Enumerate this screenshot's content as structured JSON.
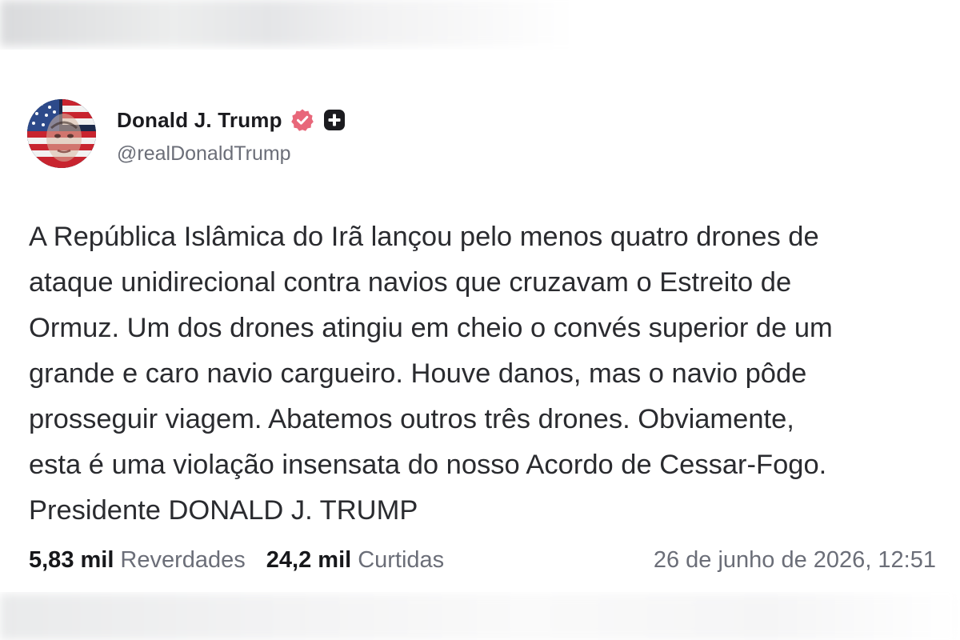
{
  "post": {
    "author": {
      "display_name": "Donald J. Trump",
      "handle": "@realDonaldTrump",
      "avatar": "avatar-image",
      "verified_icon": "verified-badge-icon",
      "plus_icon": "plus-badge-icon"
    },
    "body_lines": [
      "A República Islâmica do Irã lançou pelo menos quatro drones de",
      "ataque unidirecional contra navios que cruzavam o Estreito de",
      "Ormuz. Um dos drones atingiu em cheio o convés superior de um",
      "grande e caro navio cargueiro. Houve danos, mas o navio pôde",
      "prosseguir viagem. Abatemos outros três drones. Obviamente,",
      "esta é uma violação insensata do nosso Acordo de Cessar-Fogo.",
      "Presidente DONALD J. TRUMP"
    ],
    "stats": {
      "reposts_value": "5,83 mil",
      "reposts_label": "Reverdades",
      "likes_value": "24,2 mil",
      "likes_label": "Curtidas"
    },
    "timestamp": "26 de junho de 2026, 12:51"
  },
  "colors": {
    "verified_badge": "#e8677a",
    "plus_badge": "#1b1b1f",
    "text_primary": "#2a2b2f",
    "text_secondary": "#6b6e78"
  }
}
